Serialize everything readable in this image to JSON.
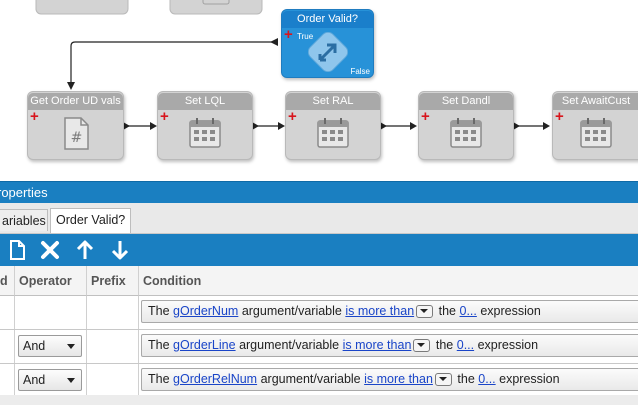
{
  "canvas": {
    "decision_node": {
      "title": "Order Valid?",
      "true_label": "True",
      "false_label": "False"
    },
    "nodes": [
      {
        "title": "Get Order UD vals",
        "icon": "document-hash-icon"
      },
      {
        "title": "Set LQL",
        "icon": "calendar-icon"
      },
      {
        "title": "Set RAL",
        "icon": "calendar-icon"
      },
      {
        "title": "Set Dandl",
        "icon": "calendar-icon"
      },
      {
        "title": "Set AwaitCust",
        "icon": "calendar-icon"
      }
    ]
  },
  "properties": {
    "header": "roperties",
    "tabs": [
      {
        "label": "ariables"
      },
      {
        "label": "Order Valid?"
      }
    ],
    "toolbar": [
      "new-document-icon",
      "delete-icon",
      "move-up-icon",
      "move-down-icon"
    ],
    "columns": [
      "d",
      "Operator",
      "Prefix",
      "Condition"
    ],
    "rows": [
      {
        "operator": "",
        "the": "The",
        "variable": "gOrderNum",
        "argvar": "argument/variable",
        "comparison": "is more than",
        "the2": "the",
        "value": "0...",
        "expression": "expression"
      },
      {
        "operator": "And",
        "the": "The",
        "variable": "gOrderLine",
        "argvar": "argument/variable",
        "comparison": "is more than",
        "the2": "the",
        "value": "0...",
        "expression": "expression"
      },
      {
        "operator": "And",
        "the": "The",
        "variable": "gOrderRelNum",
        "argvar": "argument/variable",
        "comparison": "is more than",
        "the2": "the",
        "value": "0...",
        "expression": "expression"
      }
    ]
  },
  "colors": {
    "accent": "#1a7fc1",
    "node_gray": "#d3d3d3",
    "node_blue": "#2792d8",
    "plus_red": "#d8151c"
  }
}
